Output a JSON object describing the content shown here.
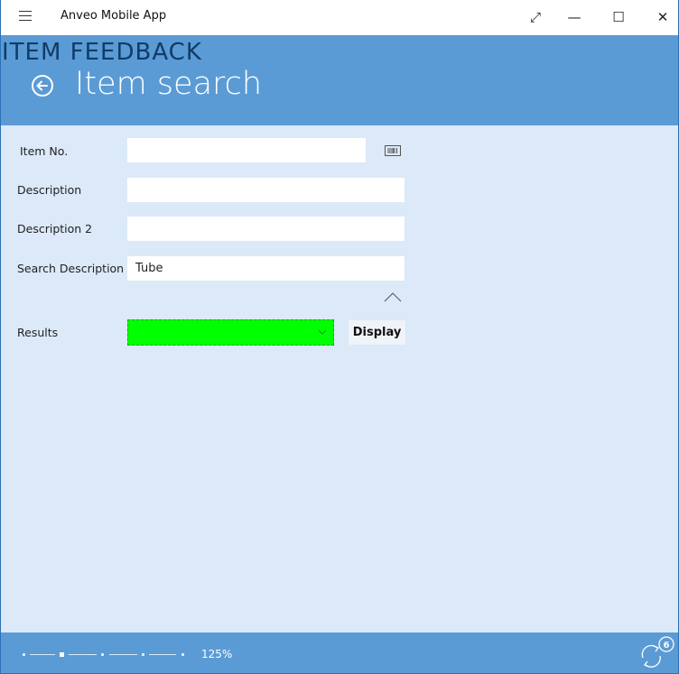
{
  "window": {
    "title": "Anveo Mobile App",
    "controls": {
      "expand": "⤢",
      "minimize": "—",
      "maximize": "☐",
      "close": "✕"
    }
  },
  "header": {
    "section": "ITEM FEEDBACK",
    "title": "Item search"
  },
  "form": {
    "item_no": {
      "label": "Item No.",
      "value": ""
    },
    "description": {
      "label": "Description",
      "value": ""
    },
    "description2": {
      "label": "Description 2",
      "value": ""
    },
    "search_description": {
      "label": "Search Description",
      "value": "Tube"
    },
    "results": {
      "label": "Results",
      "selected": ""
    },
    "display_button": "Display"
  },
  "footer": {
    "zoom_level": "125%",
    "sync_count": "6"
  },
  "colors": {
    "header_bg": "#5b9bd5",
    "content_bg": "#dbe9f9",
    "results_highlight": "#00ff00"
  },
  "icons": [
    "menu-icon",
    "expand-icon",
    "minimize-icon",
    "maximize-icon",
    "close-icon",
    "back-arrow-icon",
    "barcode-icon",
    "chevron-up-icon",
    "chevron-down-icon",
    "sync-icon"
  ]
}
